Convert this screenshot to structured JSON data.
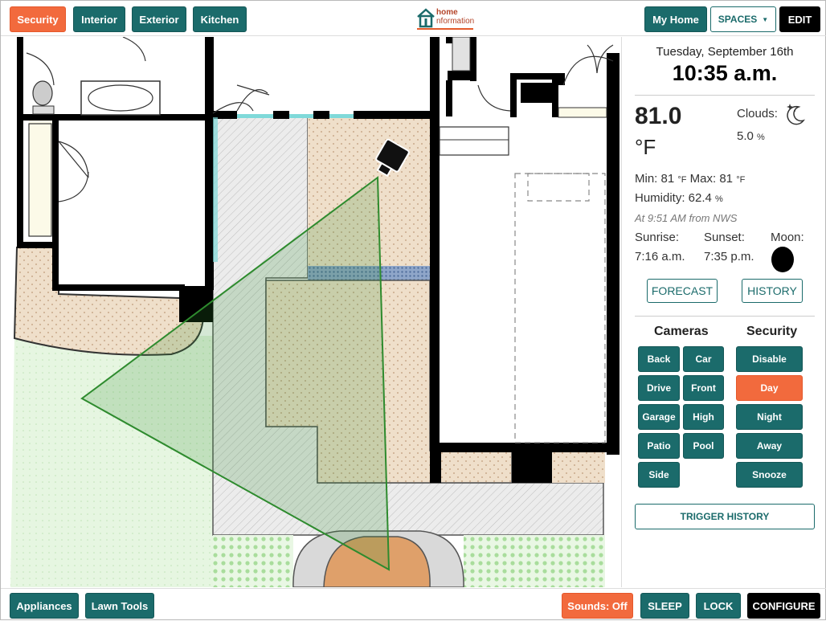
{
  "header": {
    "tabs": [
      {
        "label": "Security",
        "active": true
      },
      {
        "label": "Interior",
        "active": false
      },
      {
        "label": "Exterior",
        "active": false
      },
      {
        "label": "Kitchen",
        "active": false
      }
    ],
    "logo_line1": "home",
    "logo_line2": "nformation",
    "my_home_label": "My Home",
    "spaces_label": "SPACES",
    "edit_label": "EDIT"
  },
  "weather": {
    "date": "Tuesday, September 16th",
    "time": "10:35 a.m.",
    "temperature": "81.0",
    "temp_unit": "°F",
    "clouds_label": "Clouds:",
    "clouds_value": "5.0",
    "clouds_unit": "%",
    "min_label": "Min: 81",
    "min_unit": "°F",
    "max_label": "Max: 81",
    "max_unit": "°F",
    "humidity_label": "Humidity: 62.4",
    "humidity_unit": "%",
    "source": "At 9:51 AM from NWS",
    "sunrise_label": "Sunrise:",
    "sunrise_value": "7:16 a.m.",
    "sunset_label": "Sunset:",
    "sunset_value": "7:35 p.m.",
    "moon_label": "Moon:",
    "forecast_label": "FORECAST",
    "history_label": "HISTORY"
  },
  "cameras": {
    "heading": "Cameras",
    "items": [
      "Back",
      "Car",
      "Drive",
      "Front",
      "Garage",
      "High",
      "Patio",
      "Pool",
      "Side"
    ]
  },
  "security": {
    "heading": "Security",
    "modes": [
      {
        "label": "Disable",
        "active": false
      },
      {
        "label": "Day",
        "active": true
      },
      {
        "label": "Night",
        "active": false
      },
      {
        "label": "Away",
        "active": false
      },
      {
        "label": "Snooze",
        "active": false
      }
    ],
    "trigger_history_label": "TRIGGER HISTORY"
  },
  "footer": {
    "appliances_label": "Appliances",
    "lawn_tools_label": "Lawn Tools",
    "sounds_label": "Sounds: Off",
    "sleep_label": "SLEEP",
    "lock_label": "LOCK",
    "configure_label": "CONFIGURE"
  },
  "colors": {
    "teal": "#1b6b6b",
    "orange": "#f26a3d",
    "black": "#000000",
    "fov_green": "#2e8b2e"
  },
  "icons": {
    "logo": "house-icon",
    "clouds": "moon-stars-icon",
    "moon_phase": "new-moon-icon",
    "camera": "security-camera-icon",
    "dropdown": "caret-down-icon"
  }
}
